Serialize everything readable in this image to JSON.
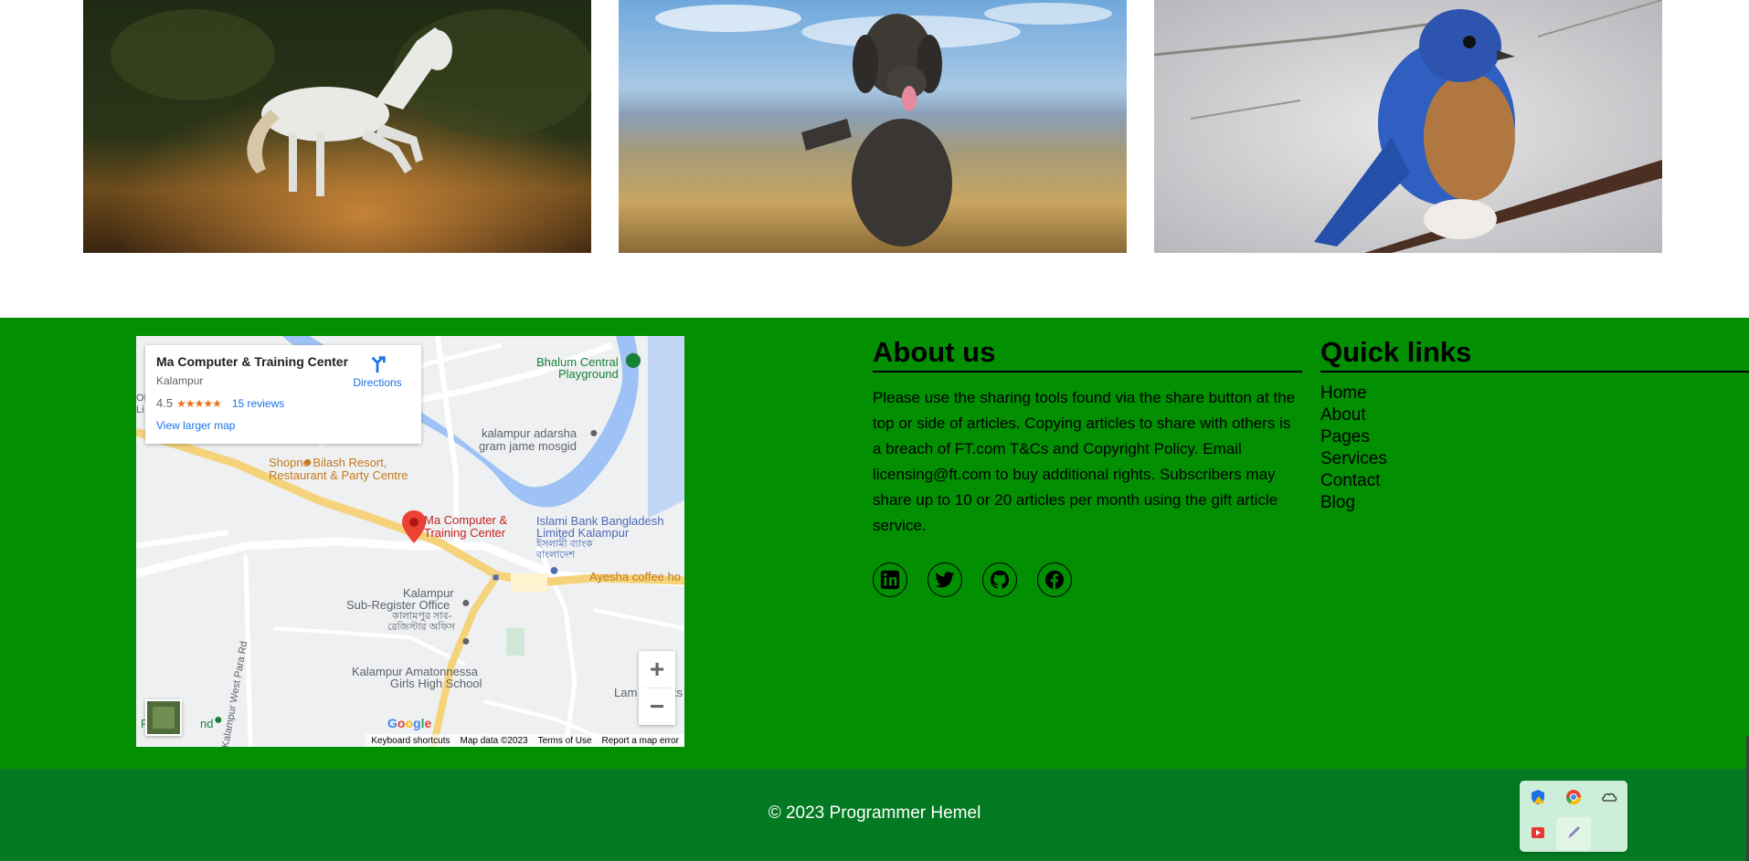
{
  "gallery": {
    "images": [
      {
        "subject": "horse"
      },
      {
        "subject": "dog"
      },
      {
        "subject": "bird"
      }
    ]
  },
  "map": {
    "card": {
      "place": "Ma Computer & Training Center",
      "area": "Kalampur",
      "rating": "4.5",
      "stars": "★★★★★",
      "reviews": "15 reviews",
      "larger_map": "View larger map",
      "directions": "Directions"
    },
    "labels": {
      "bhalum1": "Bhalum Central",
      "bhalum2": "Playground",
      "adarsha1": "kalampur adarsha",
      "adarsha2": "gram jame mosgid",
      "shopno1": "Shopno Bilash Resort,",
      "shopno2": "Restaurant & Party Centre",
      "ma1": "Ma Computer &",
      "ma2": "Training Center",
      "islami1": "Islami Bank Bangladesh",
      "islami2": "Limited Kalampur",
      "islami3": "ইসলামী ব্যাংক",
      "islami4": "বাংলাদেশ",
      "coffee": "Ayesha coffee ho",
      "subreg1": "Kalampur",
      "subreg2": "Sub-Register Office",
      "subreg3": "কালামপুর সাব-",
      "subreg4": "রেজিস্টার অফিস",
      "school1": "Kalampur Amatonnessa",
      "school2": "Girls High School",
      "lam": "Lam",
      "ks": "ks",
      "pla": "Pl",
      "nd": "nd",
      "road": "Kalampur West Para Rd",
      "od": "OD",
      "li": "Li"
    },
    "zoom_in": "+",
    "zoom_out": "−",
    "google": "Google",
    "attribution": [
      "Keyboard shortcuts",
      "Map data ©2023",
      "Terms of Use",
      "Report a map error"
    ]
  },
  "about": {
    "title": "About us",
    "text": "Please use the sharing tools found via the share button at the top or side of articles. Copying articles to share with others is a breach of FT.com T&Cs and Copyright Policy. Email licensing@ft.com to buy additional rights. Subscribers may share up to 10 or 20 articles per month using the gift article service.",
    "social": [
      {
        "icon": "linkedin-icon"
      },
      {
        "icon": "twitter-icon"
      },
      {
        "icon": "github-icon"
      },
      {
        "icon": "facebook-icon"
      }
    ]
  },
  "quick_links": {
    "title": "Quick links",
    "items": [
      "Home",
      "About",
      "Pages",
      "Services",
      "Contact",
      "Blog"
    ]
  },
  "footer": {
    "copyright": "© 2023 Programmer Hemel"
  },
  "colors": {
    "footer_green": "#028f02",
    "bottom_green": "#037a22",
    "tray_bg": "#cdeed8"
  },
  "tray": {
    "icons": [
      "shield-warning-icon",
      "chrome-icon",
      "cloud-icon",
      "video-recorder-icon",
      "pen-icon"
    ]
  }
}
